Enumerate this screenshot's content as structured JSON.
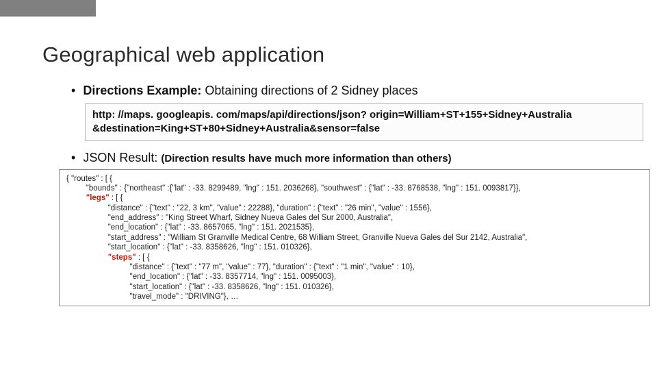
{
  "title": "Geographical web application",
  "bullet1_bold": "Directions Example:",
  "bullet1_rest": " Obtaining directions of 2 Sidney places",
  "url_line1": "http: //maps. googleapis. com/maps/api/directions/json? origin=William+ST+155+Sidney+Australia",
  "url_line2": "&destination=King+ST+80+Sidney+Australia&sensor=false",
  "bullet2": "JSON Result:",
  "bullet2_paren": "(Direction results have much more information than others)",
  "json_lines": [
    "{ \"routes\" : [ {",
    "         \"bounds\" : {\"northeast\" :{\"lat\" : -33. 8299489, \"lng\" : 151. 2036268}, \"southwest\" : {\"lat\" : -33. 8768538, \"lng\" : 151. 0093817}},",
    "         HL_OPEN\"legs\"HL_CLOSE : [ {",
    "                   \"distance\" : {\"text\" : \"22, 3 km\", \"value\" : 22288}, \"duration\" : {\"text\" : \"26 min\", \"value\" : 1556},",
    "                   \"end_address\" : \"King Street Wharf, Sidney Nueva Gales del Sur 2000, Australia\",",
    "                   \"end_location\" : {\"lat\" : -33. 8657065, \"lng\" : 151. 2021535},",
    "                   \"start_address\" : \"William St Granville Medical Centre, 68 William Street, Granville Nueva Gales del Sur 2142, Australia\",",
    "                   \"start_location\" : {\"lat\" : -33. 8358626, \"lng\" : 151. 010326},",
    "                   HL_OPEN\"steps\"HL_CLOSE : [ {",
    "                             \"distance\" : {\"text\" : \"77 m\", \"value\" : 77}, \"duration\" : {\"text\" : \"1 min\", \"value\" : 10},",
    "                             \"end_location\" : {\"lat\" : -33. 8357714, \"lng\" : 151. 0095003},",
    "                             \"start_location\" : {\"lat\" : -33. 8358626, \"lng\" : 151. 010326},",
    "                             \"travel_mode\" : \"DRIVING\"}, …"
  ]
}
